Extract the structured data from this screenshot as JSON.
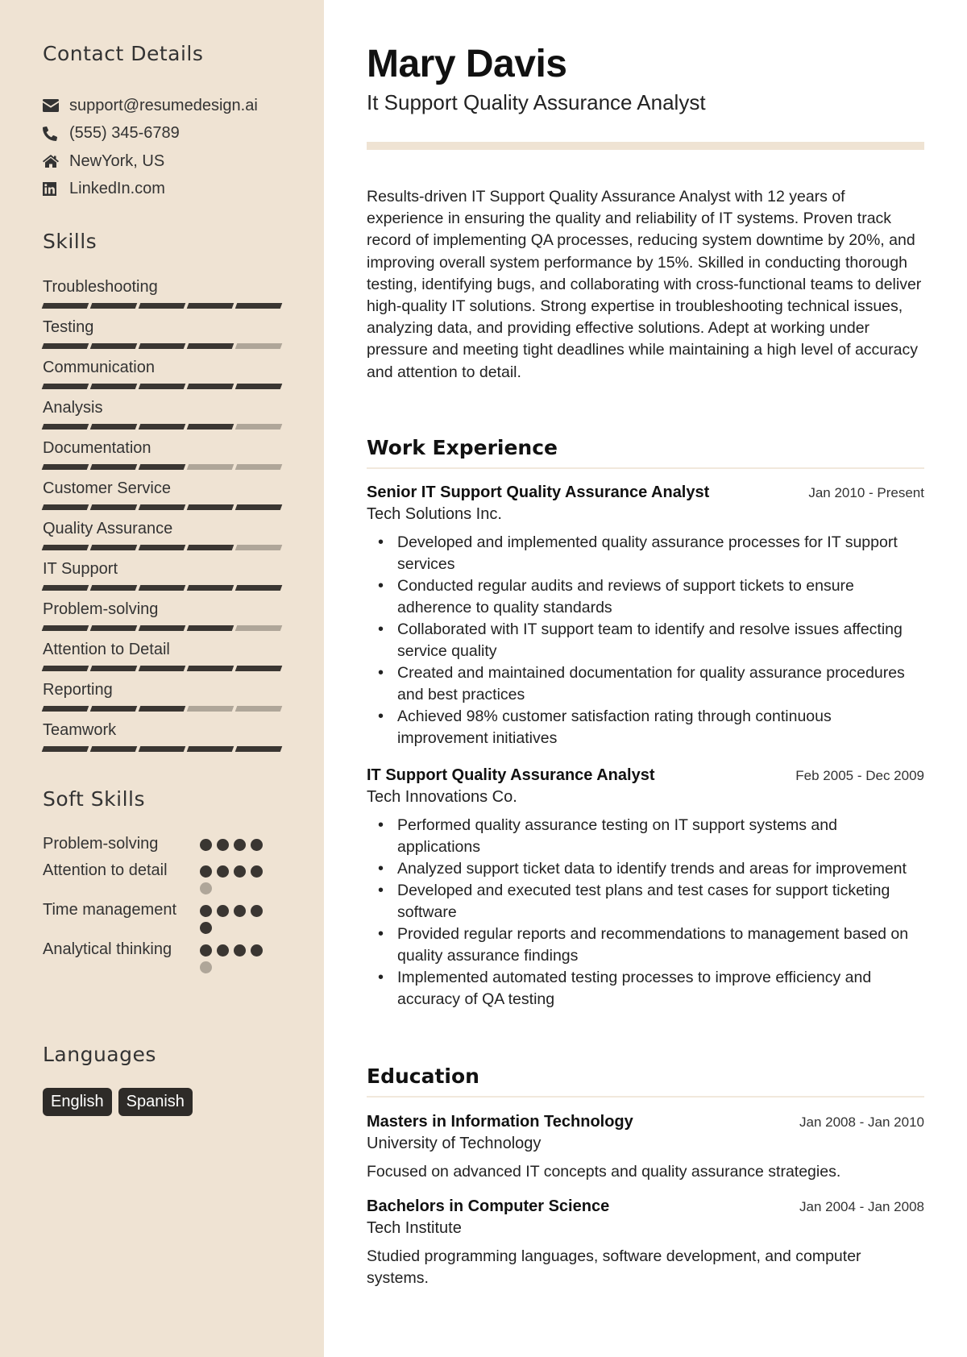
{
  "sidebar": {
    "contact": {
      "heading": "Contact Details",
      "items": [
        {
          "icon": "envelope-icon",
          "text": "support@resumedesign.ai"
        },
        {
          "icon": "phone-icon",
          "text": "(555) 345-6789"
        },
        {
          "icon": "home-icon",
          "text": "NewYork, US"
        },
        {
          "icon": "linkedin-icon",
          "text": "LinkedIn.com"
        }
      ]
    },
    "skills": {
      "heading": "Skills",
      "items": [
        {
          "label": "Troubleshooting",
          "level": 5,
          "max": 5
        },
        {
          "label": "Testing",
          "level": 4,
          "max": 5
        },
        {
          "label": "Communication",
          "level": 5,
          "max": 5
        },
        {
          "label": "Analysis",
          "level": 4,
          "max": 5
        },
        {
          "label": "Documentation",
          "level": 3,
          "max": 5
        },
        {
          "label": "Customer Service",
          "level": 5,
          "max": 5
        },
        {
          "label": "Quality Assurance",
          "level": 4,
          "max": 5
        },
        {
          "label": "IT Support",
          "level": 5,
          "max": 5
        },
        {
          "label": "Problem-solving",
          "level": 4,
          "max": 5
        },
        {
          "label": "Attention to Detail",
          "level": 5,
          "max": 5
        },
        {
          "label": "Reporting",
          "level": 3,
          "max": 5
        },
        {
          "label": "Teamwork",
          "level": 5,
          "max": 5
        }
      ]
    },
    "soft_skills": {
      "heading": "Soft Skills",
      "items": [
        {
          "label": "Problem-solving",
          "level": 4,
          "max": 4
        },
        {
          "label": "Attention to detail",
          "level": 4,
          "max": 5
        },
        {
          "label": "Time management",
          "level": 5,
          "max": 5
        },
        {
          "label": "Analytical thinking",
          "level": 4,
          "max": 5
        }
      ]
    },
    "languages": {
      "heading": "Languages",
      "items": [
        "English",
        "Spanish"
      ]
    }
  },
  "header": {
    "name": "Mary Davis",
    "role": "It Support Quality Assurance Analyst"
  },
  "summary": "Results-driven IT Support Quality Assurance Analyst with 12 years of experience in ensuring the quality and reliability of IT systems. Proven track record of implementing QA processes, reducing system downtime by 20%, and improving overall system performance by 15%. Skilled in conducting thorough testing, identifying bugs, and collaborating with cross-functional teams to deliver high-quality IT solutions. Strong expertise in troubleshooting technical issues, analyzing data, and providing effective solutions. Adept at working under pressure and meeting tight deadlines while maintaining a high level of accuracy and attention to detail.",
  "experience": {
    "heading": "Work Experience",
    "jobs": [
      {
        "title": "Senior IT Support Quality Assurance Analyst",
        "dates": "Jan 2010 - Present",
        "company": "Tech Solutions Inc.",
        "bullets": [
          "Developed and implemented quality assurance processes for IT support services",
          "Conducted regular audits and reviews of support tickets to ensure adherence to quality standards",
          "Collaborated with IT support team to identify and resolve issues affecting service quality",
          "Created and maintained documentation for quality assurance procedures and best practices",
          "Achieved 98% customer satisfaction rating through continuous improvement initiatives"
        ]
      },
      {
        "title": "IT Support Quality Assurance Analyst",
        "dates": "Feb 2005 - Dec 2009",
        "company": "Tech Innovations Co.",
        "bullets": [
          "Performed quality assurance testing on IT support systems and applications",
          "Analyzed support ticket data to identify trends and areas for improvement",
          "Developed and executed test plans and test cases for support ticketing software",
          "Provided regular reports and recommendations to management based on quality assurance findings",
          "Implemented automated testing processes to improve efficiency and accuracy of QA testing"
        ]
      }
    ]
  },
  "education": {
    "heading": "Education",
    "items": [
      {
        "degree": "Masters in Information Technology",
        "dates": "Jan 2008 - Jan 2010",
        "school": "University of Technology",
        "description": "Focused on advanced IT concepts and quality assurance strategies."
      },
      {
        "degree": "Bachelors in Computer Science",
        "dates": "Jan 2004 - Jan 2008",
        "school": "Tech Institute",
        "description": "Studied programming languages, software development, and computer systems."
      }
    ]
  }
}
